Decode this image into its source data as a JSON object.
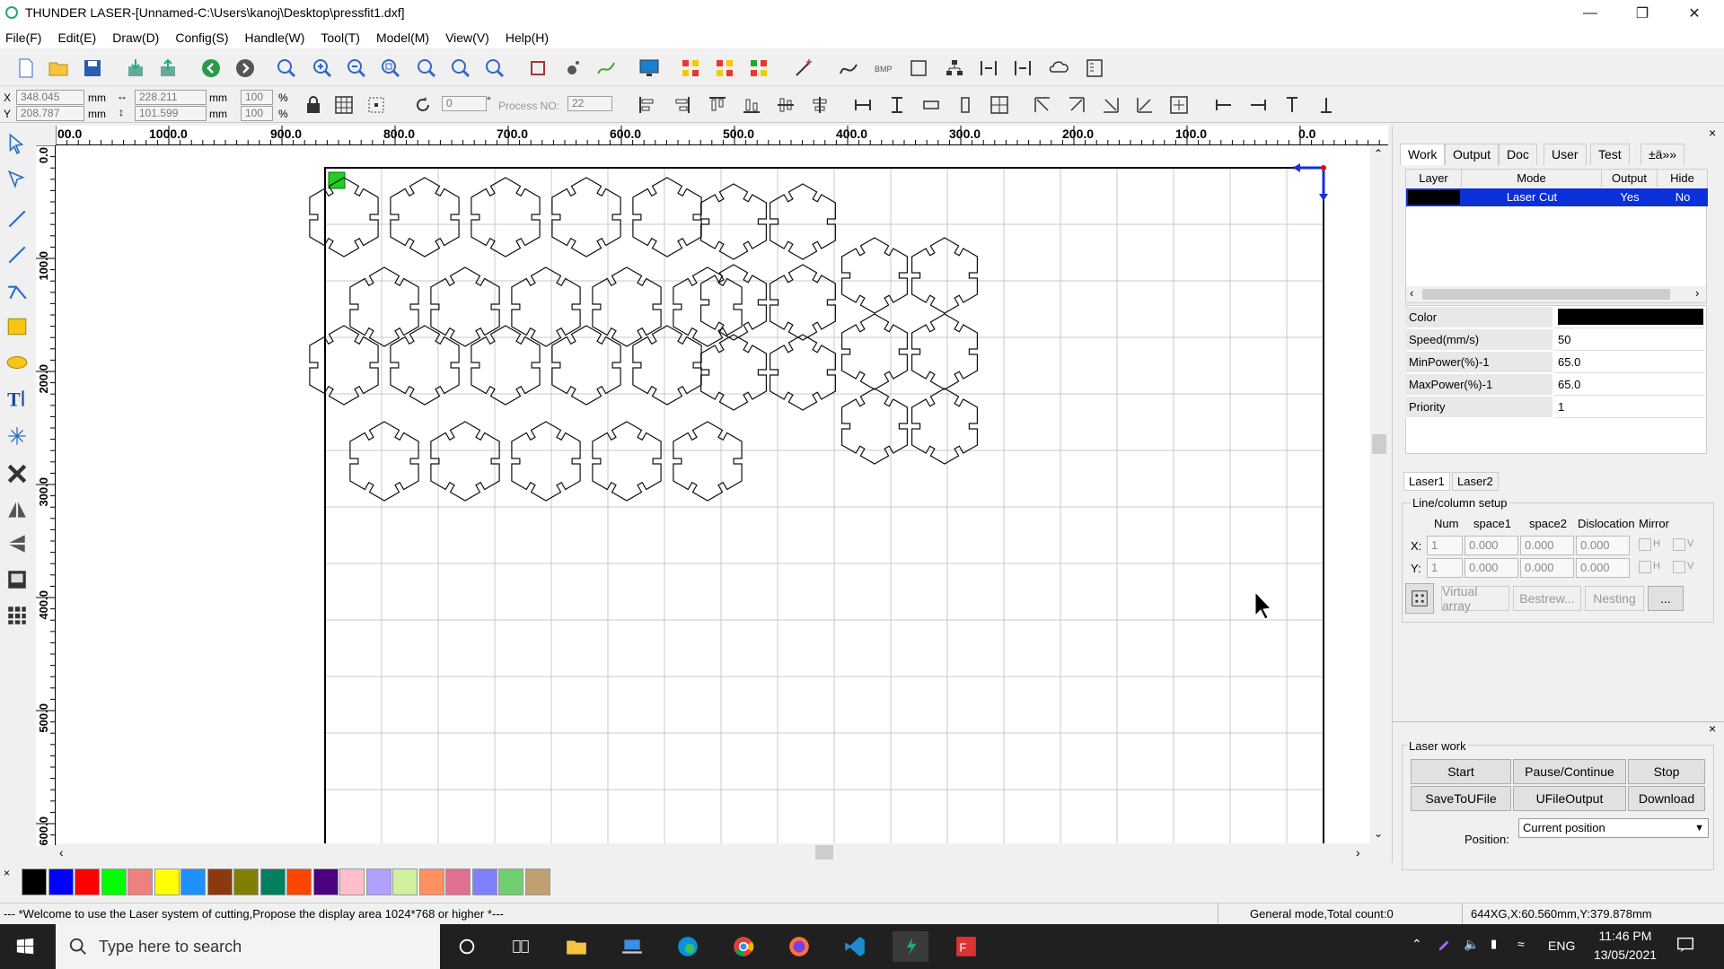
{
  "window": {
    "title": "THUNDER LASER-[Unnamed-C:\\Users\\kanoj\\Desktop\\pressfit1.dxf]"
  },
  "menu": [
    "File(F)",
    "Edit(E)",
    "Draw(D)",
    "Config(S)",
    "Handle(W)",
    "Tool(T)",
    "Model(M)",
    "View(V)",
    "Help(H)"
  ],
  "coords": {
    "x_label": "X",
    "x_value": "348.045",
    "x_unit": "mm",
    "y_label": "Y",
    "y_value": "208.787",
    "y_unit": "mm",
    "w_value": "228.211",
    "w_unit": "mm",
    "h_value": "101.599",
    "h_unit": "mm",
    "sx_pct": "100",
    "sy_pct": "100",
    "pct": "%",
    "rotate": "0",
    "deg": "°",
    "process_no_label": "Process NO:",
    "process_no": "22"
  },
  "ruler_top": [
    "00.0",
    "1000.0",
    "900.0",
    "800.0",
    "700.0",
    "600.0",
    "500.0",
    "400.0",
    "300.0",
    "200.0",
    "100.0",
    "0.0"
  ],
  "ruler_left": [
    "0.0",
    "100.0",
    "200.0",
    "300.0",
    "400.0",
    "500.0",
    "600.0"
  ],
  "tabs": [
    "Work",
    "Output",
    "Doc",
    "User",
    "Test",
    "±ä»»"
  ],
  "layer_table": {
    "headers": [
      "Layer",
      "Mode",
      "Output",
      "Hide"
    ],
    "rows": [
      {
        "mode": "Laser Cut",
        "output": "Yes",
        "hide": "No",
        "color": "#000000"
      }
    ]
  },
  "props": [
    {
      "key": "Color",
      "value": ""
    },
    {
      "key": "Speed(mm/s)",
      "value": "50"
    },
    {
      "key": "MinPower(%)-1",
      "value": "65.0"
    },
    {
      "key": "MaxPower(%)-1",
      "value": "65.0"
    },
    {
      "key": "Priority",
      "value": "1"
    }
  ],
  "laser_tabs": [
    "Laser1",
    "Laser2"
  ],
  "line_column": {
    "title": "Line/column setup",
    "headers": [
      "Num",
      "space1",
      "space2",
      "Dislocation",
      "Mirror"
    ],
    "x_label": "X:",
    "y_label": "Y:",
    "x": [
      "1",
      "0.000",
      "0.000",
      "0.000"
    ],
    "y": [
      "1",
      "0.000",
      "0.000",
      "0.000"
    ],
    "h": "H",
    "v": "V",
    "buttons": [
      "Virtual array",
      "Bestrew...",
      "Nesting",
      "..."
    ]
  },
  "laser_work": {
    "title": "Laser work",
    "buttons": [
      "Start",
      "Pause/Continue",
      "Stop",
      "SaveToUFile",
      "UFileOutput",
      "Download"
    ],
    "position_label": "Position:",
    "position_value": "Current position"
  },
  "palette": [
    "#000000",
    "#0000ff",
    "#ff0000",
    "#00ff00",
    "#f08080",
    "#ffff00",
    "#1e90ff",
    "#8b3a0f",
    "#808000",
    "#008060",
    "#ff4500",
    "#4b0082",
    "#ffc0cb",
    "#b0a0ff",
    "#d0f0a0",
    "#ff9060",
    "#e07090",
    "#8080ff",
    "#70d070",
    "#c0a070"
  ],
  "status": {
    "message": "--- *Welcome to use the Laser system of cutting,Propose the display area 1024*768 or higher *---",
    "mode": "General mode,Total count:0",
    "pos": "644XG,X:60.560mm,Y:379.878mm"
  },
  "taskbar": {
    "search_placeholder": "Type here to search",
    "time": "11:46 PM",
    "date": "13/05/2021",
    "lang": "ENG"
  }
}
